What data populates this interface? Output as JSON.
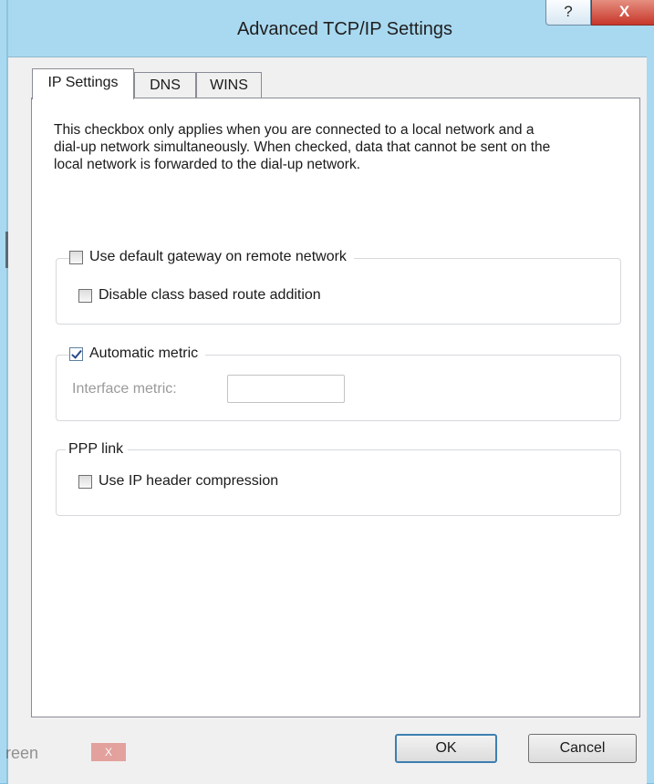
{
  "window": {
    "title": "Advanced TCP/IP Settings",
    "help_label": "?",
    "close_label": "X"
  },
  "tabs": [
    {
      "label": "IP Settings",
      "active": true
    },
    {
      "label": "DNS",
      "active": false
    },
    {
      "label": "WINS",
      "active": false
    }
  ],
  "description": "This checkbox only applies when you are connected to a local network and a dial-up network simultaneously.  When checked, data that cannot be sent on the local network is forwarded to the dial-up network.",
  "gateway_group": {
    "use_default_gateway": {
      "label": "Use default gateway on remote network",
      "checked": false
    },
    "disable_class_route": {
      "label": "Disable class based route addition",
      "checked": false
    }
  },
  "metric_group": {
    "automatic_metric": {
      "label": "Automatic metric",
      "checked": true
    },
    "interface_metric_label": "Interface metric:",
    "interface_metric_value": ""
  },
  "ppp_group": {
    "title": "PPP link",
    "ip_header_compression": {
      "label": "Use IP header compression",
      "checked": false
    }
  },
  "buttons": {
    "ok_label": "OK",
    "cancel_label": "Cancel"
  },
  "background_window": {
    "fragment_text": "reen",
    "close_label": "X"
  },
  "colors": {
    "title_bar": "#a9d9f0",
    "close_button": "#c7362a",
    "default_button_border": "#3c7fb1"
  }
}
